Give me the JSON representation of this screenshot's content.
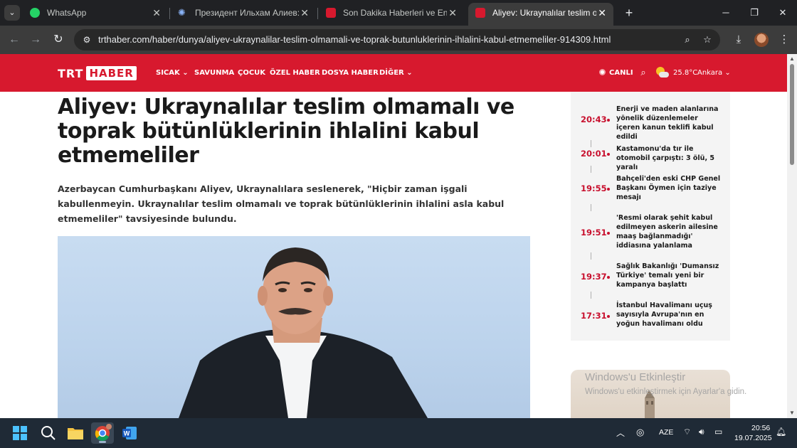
{
  "browser": {
    "tabs": [
      {
        "title": "WhatsApp",
        "favicon": "whatsapp-icon",
        "active": false
      },
      {
        "title": "Президент Ильхам Алиев: Кар",
        "favicon": "snowflake-icon",
        "active": false
      },
      {
        "title": "Son Dakika Haberleri ve En Son",
        "favicon": "trt-icon",
        "active": false
      },
      {
        "title": "Aliyev: Ukraynalılar teslim olmam",
        "favicon": "trt-icon",
        "active": true
      }
    ],
    "url": "trthaber.com/haber/dunya/aliyev-ukraynalilar-teslim-olmamali-ve-toprak-butunluklerinin-ihlalini-kabul-etmemeliler-914309.html",
    "tab_search_icon": "chevron-down-icon",
    "new_tab_icon": "plus-icon"
  },
  "site": {
    "logo_left": "TRT",
    "logo_right": "HABER",
    "menu": [
      "SICAK",
      "SAVUNMA",
      "ÇOCUK",
      "ÖZEL HABER",
      "DOSYA HABER",
      "DİĞER"
    ],
    "live_label": "CANLI",
    "temperature": "25.8°C",
    "city": "Ankara",
    "brand_color": "#d7192e"
  },
  "article": {
    "headline": "Aliyev: Ukraynalılar teslim olmamalı ve toprak bütünlüklerinin ihlalini kabul etmemeliler",
    "lead": "Azerbaycan Cumhurbaşkanı Aliyev, Ukraynalılara seslenerek, \"Hiçbir zaman işgali kabullenmeyin. Ukraynalılar teslim olmamalı ve toprak bütünlüklerinin ihlalini asla kabul etmemeliler\" tavsiyesinde bulundu."
  },
  "sidebar": {
    "items": [
      {
        "time": "20:43",
        "text": "Enerji ve maden alanlarına yönelik düzenlemeler içeren kanun teklifi kabul edildi"
      },
      {
        "time": "20:01",
        "text": "Kastamonu'da tır ile otomobil çarpıştı: 3 ölü, 5 yaralı"
      },
      {
        "time": "19:55",
        "text": "Bahçeli'den eski CHP Genel Başkanı Öymen için taziye mesajı"
      },
      {
        "time": "19:51",
        "text": "'Resmi olarak şehit kabul edilmeyen askerin ailesine maaş bağlanmadığı' iddiasına yalanlama"
      },
      {
        "time": "19:37",
        "text": "Sağlık Bakanlığı 'Dumansız Türkiye' temalı yeni bir kampanya başlattı"
      },
      {
        "time": "17:31",
        "text": "İstanbul Havalimanı uçuş sayısıyla Avrupa'nın en yoğun havalimanı oldu"
      }
    ]
  },
  "watermark": {
    "title": "Windows'u Etkinleştir",
    "subtitle": "Windows'u etkinleştirmek için Ayarlar'a gidin."
  },
  "taskbar": {
    "language": "AZE",
    "time": "20:56",
    "date": "19.07.2025"
  }
}
